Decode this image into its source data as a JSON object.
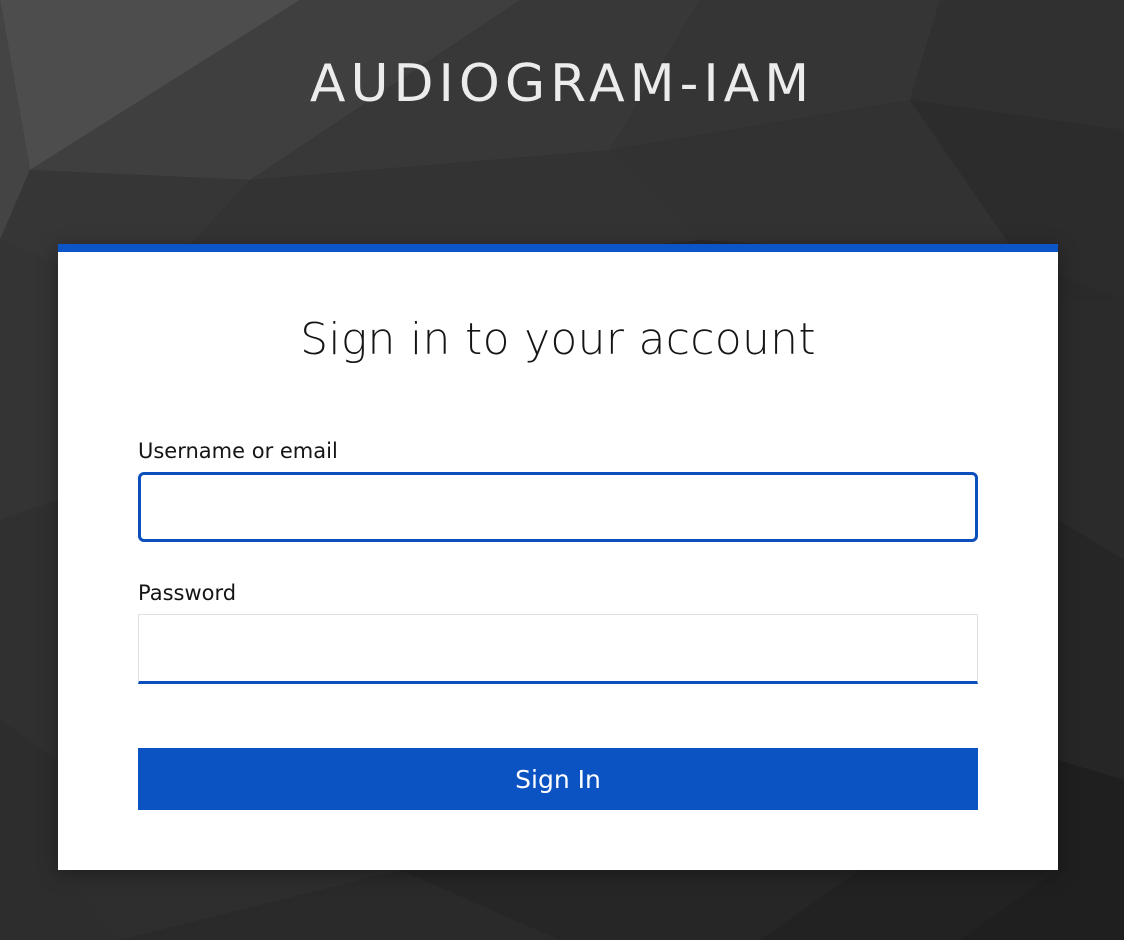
{
  "brand": {
    "title": "AUDIOGRAM-IAM"
  },
  "login_form": {
    "heading": "Sign in to your account",
    "username": {
      "label": "Username or email",
      "value": "",
      "placeholder": ""
    },
    "password": {
      "label": "Password",
      "value": "",
      "placeholder": ""
    },
    "submit_label": "Sign In"
  },
  "colors": {
    "accent": "#0b55c7",
    "button": "#0b52c2",
    "background": "#2b2b2b",
    "card": "#ffffff",
    "title_text": "#ececec"
  }
}
